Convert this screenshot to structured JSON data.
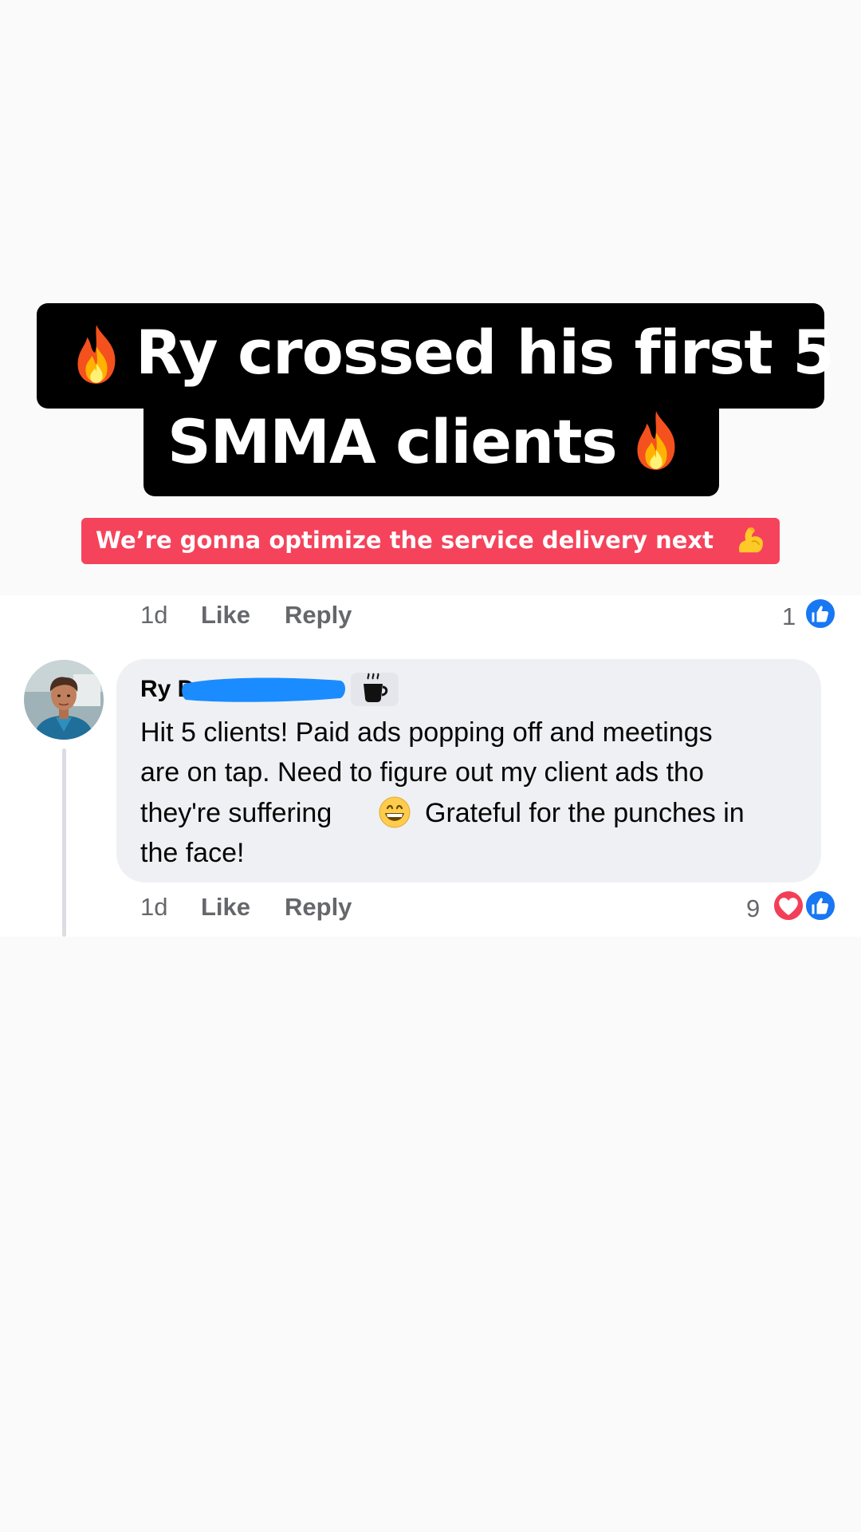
{
  "story": {
    "headline_line1": "Ry crossed his first 5",
    "headline_line2": "SMMA clients",
    "subheadline": "We’re gonna optimize the service delivery next"
  },
  "comment_top_meta": {
    "time": "1d",
    "like_label": "Like",
    "reply_label": "Reply",
    "reaction_count": "1"
  },
  "comment": {
    "author_prefix": "Ry D",
    "lines": [
      "Hit 5 clients! Paid ads popping off and meetings",
      "are on tap. Need to figure out my client ads tho",
      "they're suffering",
      "Grateful for the punches in",
      "the face!"
    ],
    "time": "1d",
    "like_label": "Like",
    "reply_label": "Reply",
    "reaction_count": "9"
  },
  "colors": {
    "banner_red": "#f5435b",
    "facebook_blue": "#1877f2",
    "heart_red": "#f33e58",
    "meta_gray": "#65676b",
    "bubble_gray": "#eff0f4"
  },
  "icons": {
    "headline": [
      "fire-icon",
      "fire-icon"
    ],
    "subheadline": "flexed-biceps-icon",
    "author_badge": "coffee-cup-icon",
    "comment_emoji": "grinning-face-icon",
    "reactions": [
      "like-icon",
      "heart-icon"
    ]
  }
}
